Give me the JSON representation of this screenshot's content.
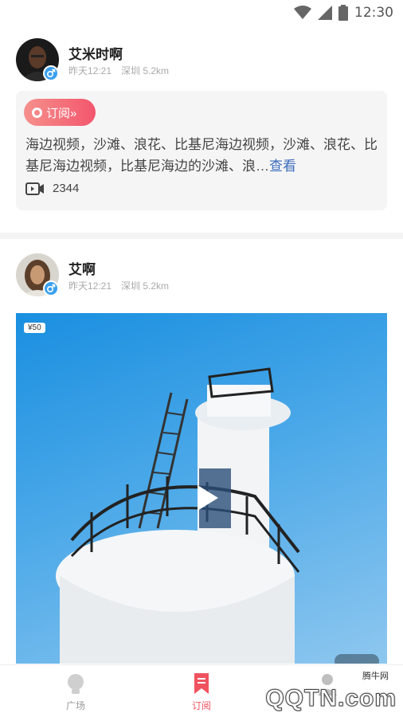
{
  "status_bar": {
    "time": "12:30"
  },
  "posts": [
    {
      "user_name": "艾米时啊",
      "time": "昨天12:21",
      "location": "深圳 5.2km",
      "subscribe_label": "订阅»",
      "text_main": "海边视频，沙滩、浪花、比基尼海边视频，沙滩、浪花、比基尼海边视频，比基尼海边的沙滩、浪…",
      "read_more": "查看",
      "view_count": "2344"
    },
    {
      "user_name": "艾啊",
      "time": "昨天12:21",
      "location": "深圳 5.2km",
      "price": "¥50"
    }
  ],
  "bottom_nav": {
    "items": [
      {
        "label": "广场",
        "icon": "bulb-icon"
      },
      {
        "label": "订阅",
        "icon": "bookmark-icon"
      },
      {
        "label": "",
        "icon": "person-icon"
      }
    ]
  },
  "watermark": {
    "cn": "腾牛网",
    "text": "QQTN.com"
  },
  "colors": {
    "accent": "#f0525f",
    "link": "#3b6dbd",
    "badge": "#3aa0f0"
  }
}
